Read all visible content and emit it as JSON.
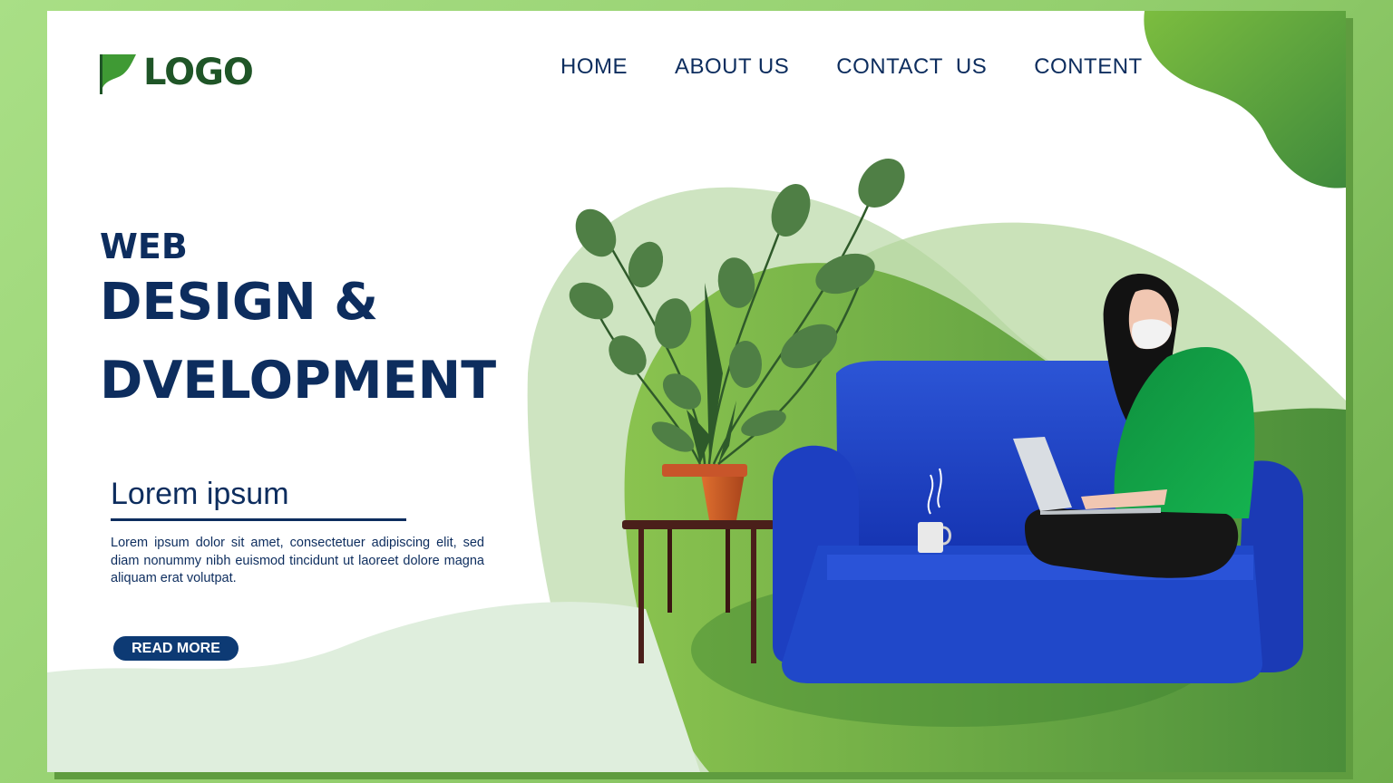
{
  "logo": {
    "text": "LOGO"
  },
  "nav": {
    "items": [
      {
        "label": "HOME"
      },
      {
        "label": "ABOUT US"
      },
      {
        "label": "CONTACT  US"
      },
      {
        "label": "CONTENT"
      }
    ]
  },
  "hero": {
    "line_small": "WEB",
    "line_1": "DESIGN &",
    "line_2": "DVELOPMENT"
  },
  "section": {
    "subtitle": "Lorem ipsum",
    "paragraph": "Lorem ipsum dolor sit amet, consectetuer adipiscing elit, sed diam nonummy nibh euismod tincidunt ut laoreet dolore magna aliquam erat volutpat.",
    "button_label": "READ MORE"
  },
  "colors": {
    "navy": "#0d2d5e",
    "green_dark": "#1f5527",
    "green_mid": "#5a9a36",
    "sofa_blue": "#1c3fc4",
    "shirt_green": "#12a14a"
  }
}
